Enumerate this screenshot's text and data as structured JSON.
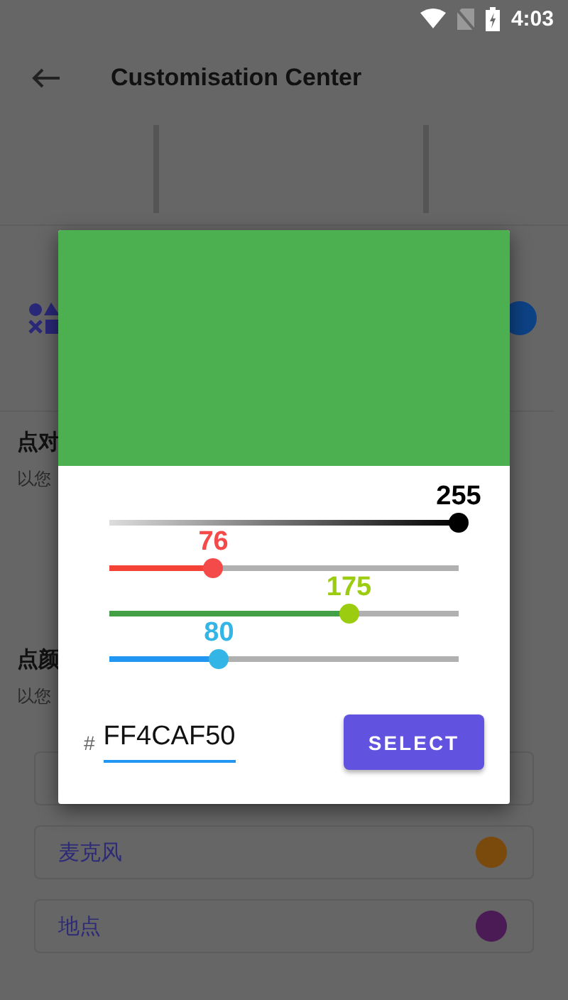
{
  "status_bar": {
    "time": "4:03"
  },
  "toolbar": {
    "title": "Customisation Center"
  },
  "feature_row": {
    "toggle": {
      "on": true
    }
  },
  "sections": [
    {
      "title": "点对",
      "subtitle": "以您"
    },
    {
      "title": "点颜",
      "subtitle": "以您"
    }
  ],
  "items": [
    {
      "kind": "covered"
    },
    {
      "kind": "item",
      "label": "麦克风",
      "color": "#7a4a0c"
    },
    {
      "kind": "item",
      "label": "地点",
      "color": "#4b1b55"
    }
  ],
  "dialog": {
    "sliders": [
      {
        "kind": "alpha",
        "value": "255",
        "level": 1
      },
      {
        "kind": "red",
        "value": "76",
        "level": 0.298
      },
      {
        "kind": "green",
        "value": "175",
        "level": 0.686
      },
      {
        "kind": "blue",
        "value": "80",
        "level": 0.314
      }
    ],
    "hex_prefix": "#",
    "hex_value": "FF4CAF50",
    "button": "SELECT"
  }
}
